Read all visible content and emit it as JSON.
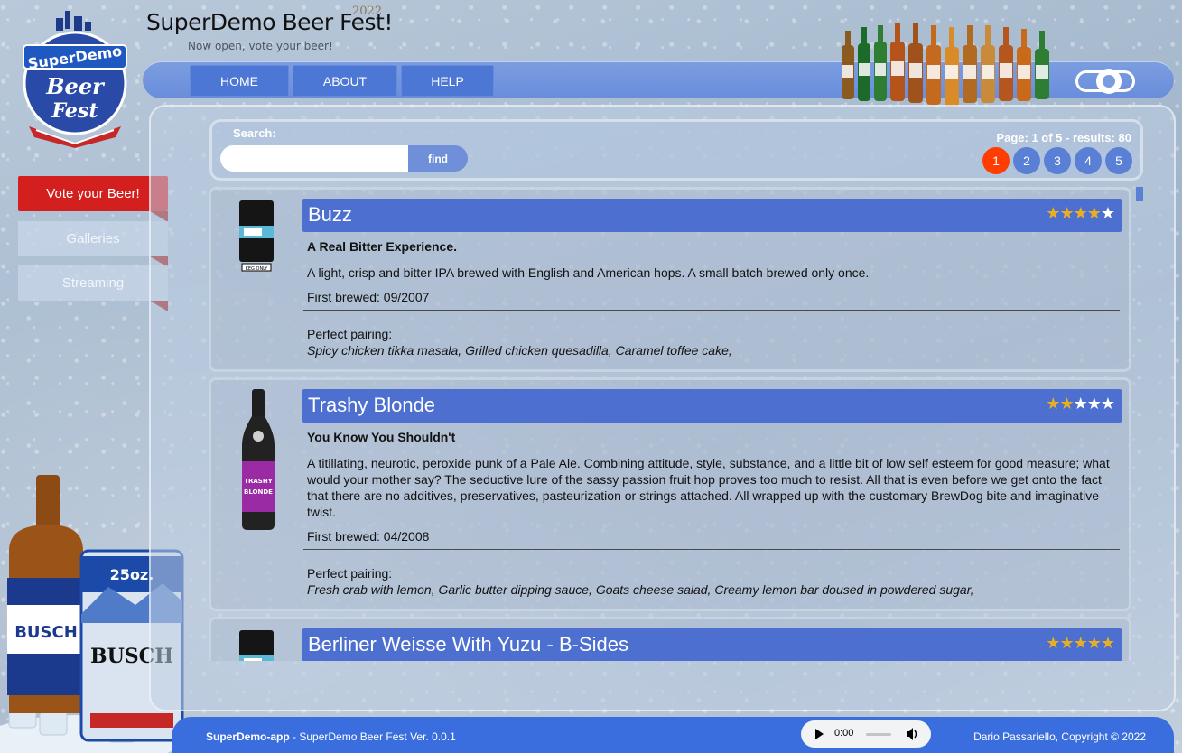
{
  "app": {
    "title": "SuperDemo Beer Fest!",
    "year": "2022",
    "subtitle": "Now open, vote your beer!",
    "logo_text": [
      "SuperDemo",
      "Beer",
      "Fest"
    ]
  },
  "nav": {
    "items": [
      {
        "label": "HOME"
      },
      {
        "label": "ABOUT"
      },
      {
        "label": "HELP"
      }
    ]
  },
  "sidebar": {
    "items": [
      {
        "label": "Vote your Beer!",
        "active": true
      },
      {
        "label": "Galleries",
        "active": false
      },
      {
        "label": "Streaming",
        "active": false
      }
    ]
  },
  "search": {
    "label": "Search:",
    "value": "",
    "placeholder": "",
    "button": "find"
  },
  "pagination": {
    "info": "Page: 1 of 5 - results: 80",
    "pages": [
      "1",
      "2",
      "3",
      "4",
      "5"
    ],
    "current": "1"
  },
  "beers": [
    {
      "name": "Buzz",
      "rating": 4,
      "tagline": "A Real Bitter Experience.",
      "description": "A light, crisp and bitter IPA brewed with English and American hops. A small batch brewed only once.",
      "first_brewed": "First brewed: 09/2007",
      "pairing_label": "Perfect pairing:",
      "pairing": "Spicy chicken tikka masala, Grilled chicken quesadilla, Caramel toffee cake,",
      "image_icon": "keg-icon",
      "image_text": "KEG ONLY"
    },
    {
      "name": "Trashy Blonde",
      "rating": 2,
      "tagline": "You Know You Shouldn't",
      "description": "A titillating, neurotic, peroxide punk of a Pale Ale. Combining attitude, style, substance, and a little bit of low self esteem for good measure; what would your mother say? The seductive lure of the sassy passion fruit hop proves too much to resist. All that is even before we get onto the fact that there are no additives, preservatives, pasteurization or strings attached. All wrapped up with the customary BrewDog bite and imaginative twist.",
      "first_brewed": "First brewed: 04/2008",
      "pairing_label": "Perfect pairing:",
      "pairing": "Fresh crab with lemon, Garlic butter dipping sauce, Goats cheese salad, Creamy lemon bar doused in powdered sugar,",
      "image_icon": "bottle-icon"
    },
    {
      "name": "Berliner Weisse With Yuzu - B-Sides",
      "rating": 5,
      "image_icon": "keg-icon"
    }
  ],
  "footer": {
    "app_name": "SuperDemo-app",
    "version_text": " - SuperDemo Beer Fest Ver. 0.0.1",
    "copyright": "Dario Passariello, Copyright © 2022",
    "audio_time": "0:00"
  },
  "colors": {
    "nav_button": "#4c77d4",
    "active_side": "#d41f1f",
    "name_bar": "#4d6fd0",
    "star_filled": "#e8b020",
    "star_empty": "#ffffff",
    "page_current": "#ff3d00",
    "footer": "#3a6ddd"
  }
}
